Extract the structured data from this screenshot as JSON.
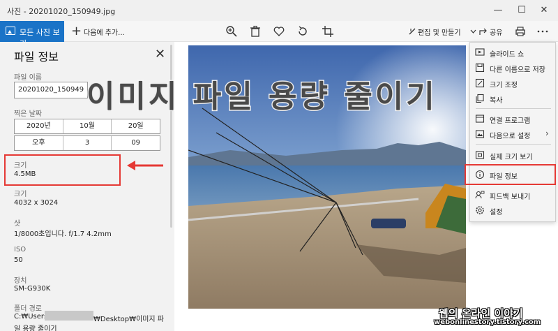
{
  "window": {
    "title": "사진 - 20201020_150949.jpg",
    "minimize": "—",
    "maximize": "☐",
    "close": "✕"
  },
  "toolbar": {
    "all_photos": "모든 사진 보기",
    "add_to": "다음에 추가...",
    "edit_create": "편집 및 만들기",
    "share": "공유",
    "icons": [
      "zoom-icon",
      "delete-icon",
      "favorite-icon",
      "rotate-icon",
      "crop-icon",
      "print-icon",
      "more-icon"
    ]
  },
  "info_panel": {
    "title": "파일 정보",
    "file_name_label": "파일 이름",
    "file_name_value": "20201020_150949",
    "date_taken_label": "찍은 날짜",
    "date": {
      "year": "2020년",
      "month": "10월",
      "day": "20일"
    },
    "time": {
      "ampm": "오후",
      "hour": "3",
      "minute": "09"
    },
    "size_label": "크기",
    "size_value": "4.5MB",
    "dimensions_label": "크기",
    "dimensions_value": "4032 x 3024",
    "shot_label": "샷",
    "shot_value": "1/8000초입니다. f/1.7 4.2mm",
    "iso_label": "ISO",
    "iso_value": "50",
    "device_label": "장치",
    "device_value": "SM-G930K",
    "folder_label": "폴더 경로",
    "folder_value_line1_a": "C:₩Users₩",
    "folder_value_line1_b": "₩Desktop₩이미지 파",
    "folder_value_line2": "일 용량 줄이기"
  },
  "overlay_title": "이미지 파일 용량 줄이기",
  "menu": {
    "items": [
      {
        "label": "슬라이드 쇼",
        "icon": "slideshow-icon"
      },
      {
        "label": "다른 이름으로 저장",
        "icon": "save-icon"
      },
      {
        "label": "크기 조정",
        "icon": "resize-icon"
      },
      {
        "label": "복사",
        "icon": "copy-icon"
      },
      {
        "label": "연결 프로그램",
        "icon": "open-with-icon"
      },
      {
        "label": "다음으로 설정",
        "icon": "set-as-icon"
      },
      {
        "label": "실제 크기 보기",
        "icon": "actual-size-icon"
      },
      {
        "label": "파일 정보",
        "icon": "info-icon"
      },
      {
        "label": "피드백 보내기",
        "icon": "feedback-icon"
      },
      {
        "label": "설정",
        "icon": "settings-icon"
      }
    ]
  },
  "watermark": {
    "line1": "웹의 온라인 이야기",
    "line2": "webonlinestory.tistory.com"
  },
  "colors": {
    "accent": "#1a73c7",
    "highlight_red": "#e53935"
  }
}
